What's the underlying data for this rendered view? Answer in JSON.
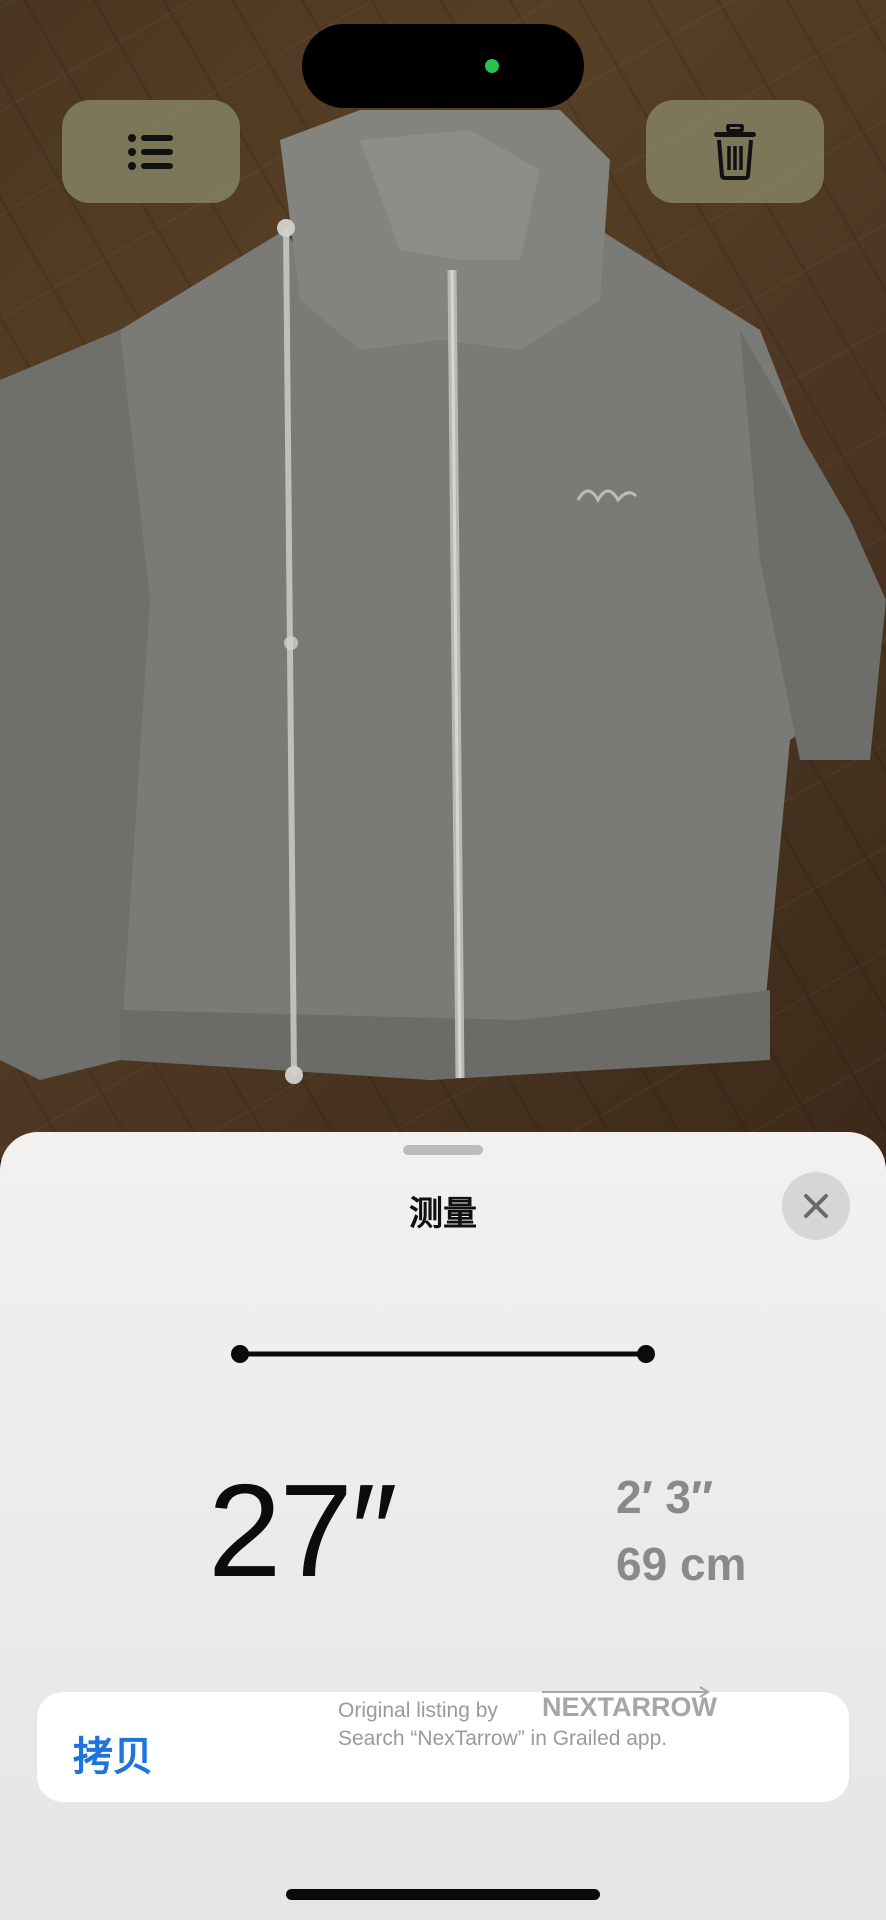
{
  "camera": {
    "list_button_icon": "list-icon",
    "trash_button_icon": "trash-icon",
    "status_dot_color": "#29c24a"
  },
  "sheet": {
    "title": "测量",
    "close_icon": "close-icon",
    "measurement": {
      "primary": "27″",
      "secondary_ft_in": "2′ 3″",
      "secondary_cm": "69 cm"
    },
    "copy_label": "拷贝"
  },
  "watermark": {
    "line1": "Original listing by",
    "brand": "NEXTARROW",
    "line2": "Search “NexTarrow” in Grailed app."
  }
}
